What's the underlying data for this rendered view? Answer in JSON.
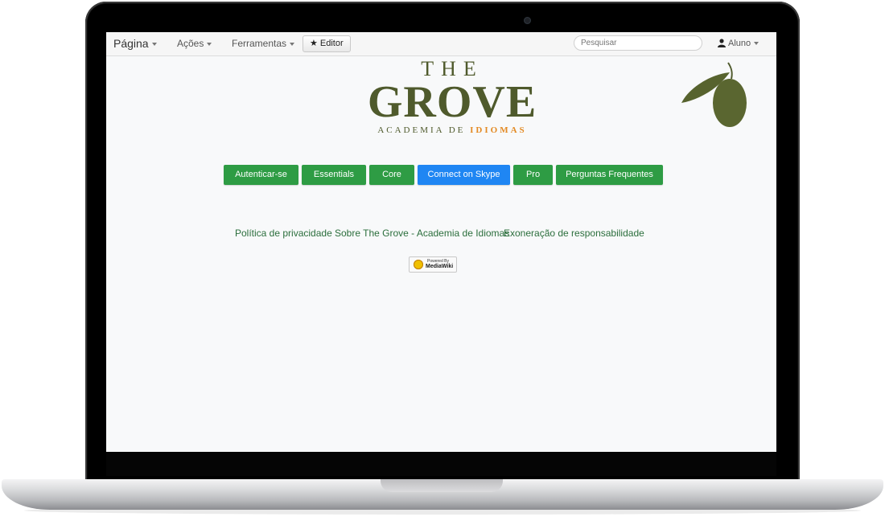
{
  "navbar": {
    "page_menu": "Página",
    "actions_menu": "Ações",
    "tools_menu": "Ferramentas",
    "editor_button": "Editor",
    "search_placeholder": "Pesquisar",
    "user_menu": "Aluno"
  },
  "logo": {
    "the": "THE",
    "grove": "GROVE",
    "sub_prefix": "ACADEMIA DE ",
    "sub_highlight": "IDIOMAS",
    "highlight_color": "#e38a23",
    "brand_color": "#4f5a2c"
  },
  "buttons": [
    {
      "label": "Autenticar-se",
      "color": "#2e9c44"
    },
    {
      "label": "Essentials",
      "color": "#2e9c44"
    },
    {
      "label": "Core",
      "color": "#2e9c44"
    },
    {
      "label": "Connect on Skype",
      "color": "#1f86f3"
    },
    {
      "label": "Pro",
      "color": "#2e9c44"
    },
    {
      "label": "Perguntas Frequentes",
      "color": "#2e9c44"
    }
  ],
  "footer": {
    "privacy": "Política de privacidade",
    "about": "Sobre The Grove - Academia de Idiomas",
    "disclaimer": "Exoneração de responsabilidade",
    "powered_small": "Powered By",
    "powered_big": "MediaWiki"
  }
}
